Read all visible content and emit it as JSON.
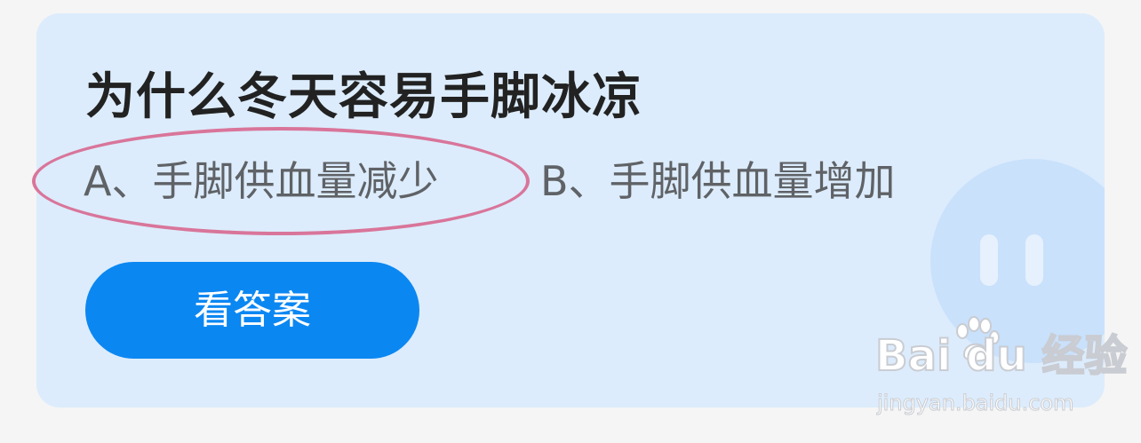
{
  "question": {
    "title": "为什么冬天容易手脚冰凉",
    "options": [
      {
        "label": "A、手脚供血量减少",
        "highlighted": true
      },
      {
        "label": "B、手脚供血量增加",
        "highlighted": false
      }
    ],
    "answer_button": "看答案"
  },
  "watermark": {
    "logo_text": "Bai du 经验",
    "url": "jingyan.baidu.com"
  },
  "colors": {
    "card_background": "#dcecfc",
    "button": "#0b87f2",
    "highlight": "#d9759a"
  }
}
